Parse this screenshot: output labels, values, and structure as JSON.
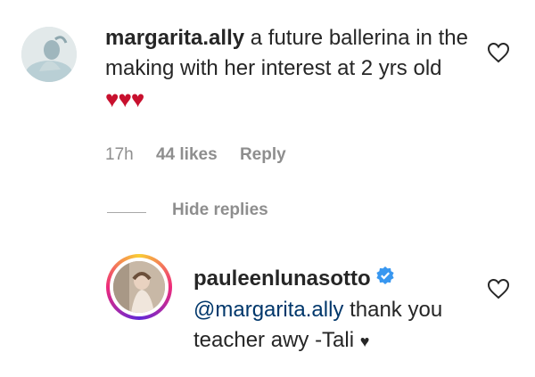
{
  "comment": {
    "username": "margarita.ally",
    "text": "a future ballerina in the making with her interest at 2 yrs old",
    "hearts": "♥♥♥",
    "time": "17h",
    "likes": "44 likes",
    "reply_label": "Reply",
    "avatar_icon": "user-avatar-icon",
    "like_icon": "heart-outline-icon"
  },
  "hide_replies_label": "Hide replies",
  "reply": {
    "username": "pauleenlunasotto",
    "verified_icon": "verified-badge-icon",
    "mention": "@margarita.ally",
    "text": " thank you teacher awy -Tali ",
    "heart": "♥",
    "like_icon": "heart-outline-icon"
  },
  "colors": {
    "username": "#262626",
    "meta": "#8e8e8e",
    "mention": "#00376b",
    "hearts": "#c8102e",
    "verified": "#3897f0"
  }
}
